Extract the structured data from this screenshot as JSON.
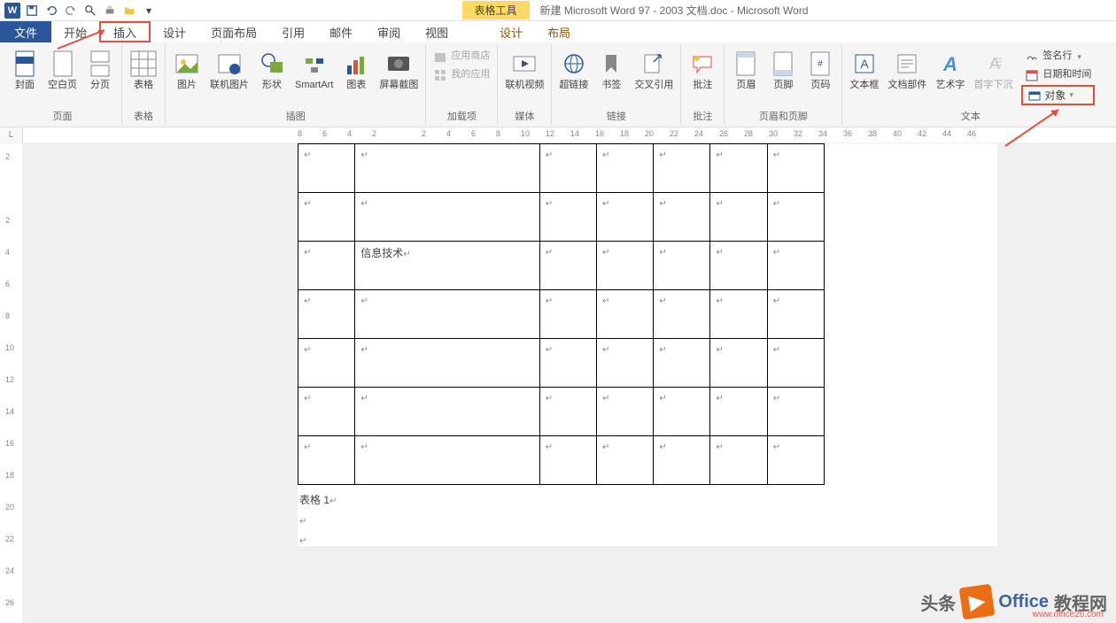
{
  "title_bar": {
    "table_tools": "表格工具",
    "document_title": "新建 Microsoft Word 97 - 2003 文档.doc - Microsoft Word"
  },
  "tabs": {
    "file": "文件",
    "home": "开始",
    "insert": "插入",
    "design": "设计",
    "page_layout": "页面布局",
    "references": "引用",
    "mailings": "邮件",
    "review": "审阅",
    "view": "视图",
    "table_design": "设计",
    "table_layout": "布局"
  },
  "ribbon": {
    "pages": {
      "cover": "封面",
      "blank": "空白页",
      "break": "分页",
      "group": "页面"
    },
    "tables": {
      "table": "表格",
      "group": "表格"
    },
    "illustrations": {
      "picture": "图片",
      "online_pic": "联机图片",
      "shapes": "形状",
      "smartart": "SmartArt",
      "chart": "图表",
      "screenshot": "屏幕截图",
      "group": "插图"
    },
    "addins": {
      "store": "应用商店",
      "myapps": "我的应用",
      "group": "加载项"
    },
    "media": {
      "online_video": "联机视频",
      "group": "媒体"
    },
    "links": {
      "hyperlink": "超链接",
      "bookmark": "书签",
      "crossref": "交叉引用",
      "group": "链接"
    },
    "comments": {
      "comment": "批注",
      "group": "批注"
    },
    "header_footer": {
      "header": "页眉",
      "footer": "页脚",
      "pageno": "页码",
      "group": "页眉和页脚"
    },
    "text": {
      "textbox": "文本框",
      "quickparts": "文档部件",
      "wordart": "艺术字",
      "dropcap": "首字下沉",
      "signature": "签名行",
      "datetime": "日期和时间",
      "object": "对象",
      "group": "文本"
    }
  },
  "h_ruler": [
    "8",
    "6",
    "4",
    "2",
    "",
    "2",
    "4",
    "6",
    "8",
    "10",
    "12",
    "14",
    "16",
    "18",
    "20",
    "22",
    "24",
    "26",
    "28",
    "30",
    "32",
    "34",
    "36",
    "38",
    "40",
    "42",
    "44",
    "46"
  ],
  "v_ruler": [
    "2",
    "",
    "2",
    "4",
    "6",
    "8",
    "10",
    "12",
    "14",
    "16",
    "18",
    "20",
    "22",
    "24",
    "26"
  ],
  "table": {
    "rows": 7,
    "cols": 7,
    "cell_r2_c1": "信息技术"
  },
  "after_table": "表格 1",
  "watermark": {
    "left": "头条",
    "brand": "Office",
    "suffix": "教程网",
    "url": "www.office26.com"
  }
}
